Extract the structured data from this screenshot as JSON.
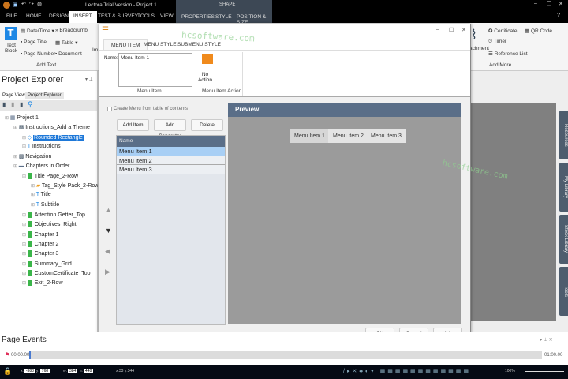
{
  "app": {
    "title": "Lectora Trial Version - Project 1",
    "contextual_group": "SHAPE"
  },
  "tabs": [
    "FILE",
    "HOME",
    "DESIGN",
    "INSERT",
    "TEST & SURVEY",
    "TOOLS",
    "VIEW",
    "PROPERTIES",
    "STYLE",
    "POSITION & SIZE"
  ],
  "ribbon": {
    "text_block": "Text Block",
    "date_time": "Date/Time",
    "breadcrumb": "Breadcrumb",
    "page_title": "Page Title",
    "table": "Table",
    "page_number": "Page Number",
    "document": "Document",
    "add_text_group": "Add Text",
    "image_partial": "Im",
    "attachment_partial": "achment",
    "certificate": "Certificate",
    "qr_code": "QR Code",
    "timer": "Timer",
    "reference_list": "Reference List",
    "add_more_group": "Add More"
  },
  "explorer": {
    "title": "Project Explorer",
    "tabs": [
      "Page View",
      "Project Explorer"
    ],
    "tree": [
      {
        "label": "Project 1",
        "level": 0,
        "icon": "project"
      },
      {
        "label": "Instructions_Add a Theme",
        "level": 1,
        "icon": "group"
      },
      {
        "label": "Rounded Rectangle",
        "level": 2,
        "icon": "shape",
        "selected": true
      },
      {
        "label": "Instructions",
        "level": 2,
        "icon": "text"
      },
      {
        "label": "Navigation",
        "level": 1,
        "icon": "group"
      },
      {
        "label": "Chapters in Order",
        "level": 1,
        "icon": "folder"
      },
      {
        "label": "Title Page_2-Row",
        "level": 2,
        "icon": "page"
      },
      {
        "label": "Tag_Style Pack_2-Row",
        "level": 3,
        "icon": "image"
      },
      {
        "label": "Title",
        "level": 3,
        "icon": "text"
      },
      {
        "label": "Subtitle",
        "level": 3,
        "icon": "text"
      },
      {
        "label": "Attention Getter_Top",
        "level": 2,
        "icon": "page"
      },
      {
        "label": "Objectives_Right",
        "level": 2,
        "icon": "page"
      },
      {
        "label": "Chapter 1",
        "level": 2,
        "icon": "chapter"
      },
      {
        "label": "Chapter 2",
        "level": 2,
        "icon": "chapter"
      },
      {
        "label": "Chapter 3",
        "level": 2,
        "icon": "chapter"
      },
      {
        "label": "Summary_Grid",
        "level": 2,
        "icon": "page"
      },
      {
        "label": "CustomCertificate_Top",
        "level": 2,
        "icon": "page"
      },
      {
        "label": "Exit_2-Row",
        "level": 2,
        "icon": "page"
      }
    ]
  },
  "dialog": {
    "tabs": [
      "MENU ITEM",
      "MENU STYLE",
      "SUBMENU STYLE"
    ],
    "name_label": "Name:",
    "name_value": "Menu Item 1",
    "menu_item_group": "Menu Item",
    "action_label": "No Action",
    "action_group": "Menu Item Action",
    "create_from_toc": "Create Menu from table of contents",
    "create_from_toc_checked": false,
    "add_item": "Add Item",
    "add_separator": "Add Separator",
    "delete": "Delete",
    "list_header": "Name",
    "items": [
      "Menu Item 1",
      "Menu Item 2",
      "Menu Item 3"
    ],
    "selected_index": 0,
    "preview_title": "Preview",
    "ok": "OK",
    "cancel": "Cancel",
    "help": "Help"
  },
  "side_tabs": [
    "Resources",
    "My Library",
    "Stock Library",
    "Tools"
  ],
  "events": {
    "title": "Page Events",
    "start": "00:00.00",
    "end": "01:00.00"
  },
  "status": {
    "x_label": "x:",
    "x": "-388",
    "y_label": "y:",
    "y": "768",
    "w_label": "w:",
    "w": "384",
    "h_label": "h:",
    "h": "448",
    "cursor": "x:33 y:344",
    "zoom": "100%"
  },
  "watermark": "hcsoftware.com"
}
